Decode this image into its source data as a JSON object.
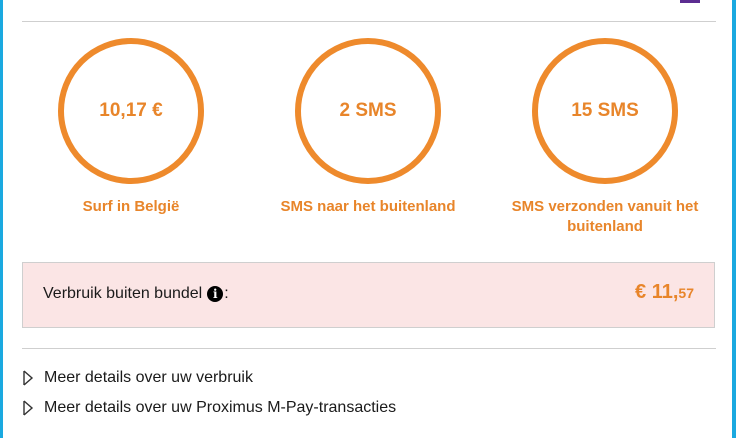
{
  "colors": {
    "accent": "#ee8a2c",
    "frame": "#1aa9e0",
    "tab": "#5c2d91",
    "alert_bg": "#fbe5e5"
  },
  "meters": [
    {
      "value": "10,17 €",
      "caption": "Surf in België"
    },
    {
      "value": "2 SMS",
      "caption": "SMS naar het buitenland"
    },
    {
      "value": "15 SMS",
      "caption": "SMS verzonden vanuit het buitenland"
    }
  ],
  "out_of_bundle": {
    "label": "Verbruik buiten bundel",
    "info_icon": "info-icon",
    "info_glyph": "i",
    "colon": ":",
    "amount_main": "€ 11,",
    "amount_cents": "57"
  },
  "links": [
    {
      "label": "Meer details over uw verbruik",
      "icon": "chevron-right-icon"
    },
    {
      "label": "Meer details over uw Proximus M-Pay-transacties",
      "icon": "chevron-right-icon"
    }
  ]
}
